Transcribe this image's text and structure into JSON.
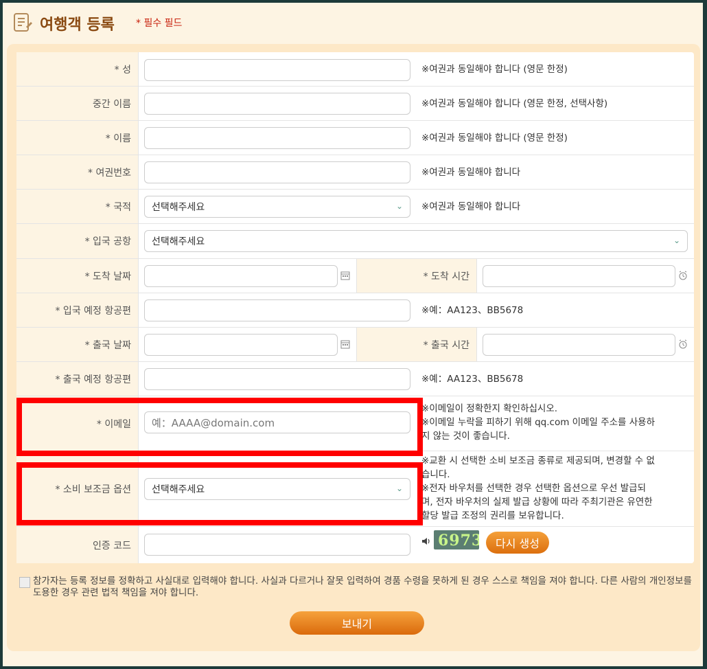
{
  "header": {
    "title": "여행객 등록",
    "required_note": "* 필수 필드",
    "icon": "document-list-icon"
  },
  "fields": {
    "last_name": {
      "label": "* 성",
      "value": "",
      "note": "※여권과 동일해야 합니다 (영문 한정)"
    },
    "middle_name": {
      "label": "중간 이름",
      "value": "",
      "note": "※여권과 동일해야 합니다 (영문 한정, 선택사항)"
    },
    "first_name": {
      "label": "* 이름",
      "value": "",
      "note": "※여권과 동일해야 합니다 (영문 한정)"
    },
    "passport": {
      "label": "* 여권번호",
      "value": "",
      "note": "※여권과 동일해야 합니다"
    },
    "nationality": {
      "label": "* 국적",
      "selected": "선택해주세요",
      "note": "※여권과 동일해야 합니다"
    },
    "airport": {
      "label": "* 입국 공항",
      "selected": "선택해주세요"
    },
    "arrival_date": {
      "label": "* 도착 날짜",
      "value": ""
    },
    "arrival_time": {
      "label": "* 도착 시간",
      "value": ""
    },
    "arrival_flight": {
      "label": "* 입국 예정 항공편",
      "value": "",
      "note": "※예：AA123、BB5678"
    },
    "departure_date": {
      "label": "* 출국 날짜",
      "value": ""
    },
    "departure_time": {
      "label": "* 출국 시간",
      "value": ""
    },
    "departure_flight": {
      "label": "* 출국 예정 항공편",
      "value": "",
      "note": "※예：AA123、BB5678"
    },
    "email": {
      "label": "* 이메일",
      "placeholder": "예：AAAA@domain.com",
      "note_lines": [
        "※이메일이 정확한지 확인하십시오.",
        "※이메일 누락을 피하기 위해 qq.com 이메일 주소를 사용하",
        "지 않는 것이 좋습니다."
      ]
    },
    "subsidy": {
      "label": "* 소비 보조금 옵션",
      "selected": "선택해주세요",
      "note_lines": [
        "※교환 시 선택한 소비 보조금 종류로 제공되며, 변경할 수 없",
        "습니다.",
        "※전자 바우처를 선택한 경우 선택한 옵션으로 우선 발급되",
        "며, 전자 바우처의 실제 발급 상황에 따라 주최기관은 유연한",
        "할당 발급 조정의 권리를 보유합니다."
      ]
    },
    "captcha": {
      "label": "인증 코드",
      "value": "",
      "code": "6973",
      "regen_label": "다시 생성"
    }
  },
  "agreement": {
    "checked": false,
    "text": "참가자는 등록 정보를 정확하고 사실대로 입력해야 합니다. 사실과 다르거나 잘못 입력하여 경품 수령을 못하게 된 경우 스스로 책임을 져야 합니다. 다른 사람의 개인정보를 도용한 경우 관련 법적 책임을 져야 합니다."
  },
  "submit_label": "보내기",
  "colors": {
    "highlight": "#ff0000",
    "accent": "#e07a1a",
    "title": "#8a4a12"
  }
}
